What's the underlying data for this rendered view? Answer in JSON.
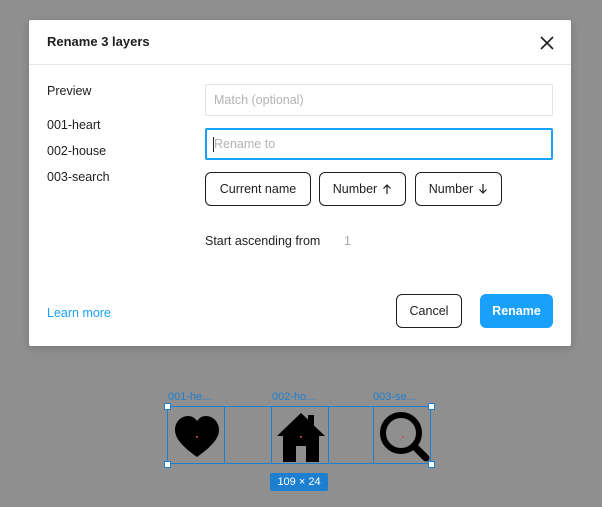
{
  "dialog": {
    "title": "Rename 3 layers",
    "preview_heading": "Preview",
    "preview_items": [
      "001-heart",
      "002-house",
      "003-search"
    ],
    "match_placeholder": "Match (optional)",
    "rename_placeholder": "Rename to",
    "chips": {
      "current_name": "Current name",
      "number_asc": "Number",
      "number_desc": "Number"
    },
    "start_label": "Start ascending from",
    "start_value": "1",
    "learn_more": "Learn more",
    "cancel": "Cancel",
    "rename": "Rename"
  },
  "canvas": {
    "layers": [
      {
        "label": "001-he...",
        "icon": "heart-icon"
      },
      {
        "label": "002-ho...",
        "icon": "house-icon"
      },
      {
        "label": "003-se...",
        "icon": "search-icon"
      }
    ],
    "selection_size": "109 × 24"
  },
  "colors": {
    "accent": "#18a0fb",
    "selection": "#1d7fd0",
    "backdrop": "#8f8f8f"
  }
}
